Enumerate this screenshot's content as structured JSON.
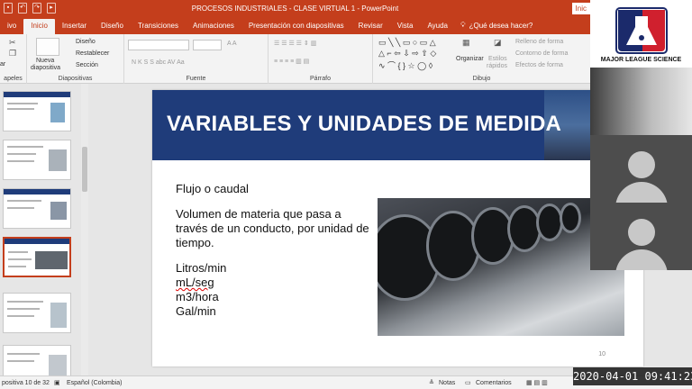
{
  "titlebar": {
    "title": "PROCESOS INDUSTRIALES - CLASE VIRTUAL 1  -  PowerPoint",
    "signin": "Inic"
  },
  "tabs": [
    {
      "label": "ivo"
    },
    {
      "label": "Inicio",
      "active": true
    },
    {
      "label": "Insertar"
    },
    {
      "label": "Diseño"
    },
    {
      "label": "Transiciones"
    },
    {
      "label": "Animaciones"
    },
    {
      "label": "Presentación con diapositivas"
    },
    {
      "label": "Revisar"
    },
    {
      "label": "Vista"
    },
    {
      "label": "Ayuda"
    }
  ],
  "tell_me": "¿Qué desea hacer?",
  "ribbon": {
    "clipboard_label": "apeles",
    "paste_label": "ar",
    "slides_label": "Diapositivas",
    "new_slide_l1": "Nueva",
    "new_slide_l2": "diapositiva",
    "layout": "Diseño",
    "reset": "Restablecer",
    "section": "Sección",
    "font_label": "Fuente",
    "font_buttons": "N   K   S   S   abc   AV   Aa",
    "paragraph_label": "Párrafo",
    "drawing_label": "Dibujo",
    "arrange": "Organizar",
    "quick_styles_l1": "Estilos",
    "quick_styles_l2": "rápidos",
    "shape_fill": "Relleno de forma",
    "shape_outline": "Contorno de forma",
    "shape_effects": "Efectos de forma"
  },
  "slide": {
    "title": "VARIABLES Y UNIDADES DE MEDIDA",
    "heading": "Flujo o caudal",
    "definition": "Volumen de materia que pasa a través de un conducto, por unidad de tiempo.",
    "units": [
      "Litros/min",
      "mL/seg",
      "m3/hora",
      "Gal/min"
    ],
    "number": "10"
  },
  "status": {
    "slide_count": "positiva 10 de 32",
    "language": "Español (Colombia)",
    "notes": "Notas",
    "comments": "Comentarios"
  },
  "video": {
    "logo_text": "MAJOR LEAGUE SCIENCE"
  },
  "timestamp": "2020-04-01  09:41:23"
}
